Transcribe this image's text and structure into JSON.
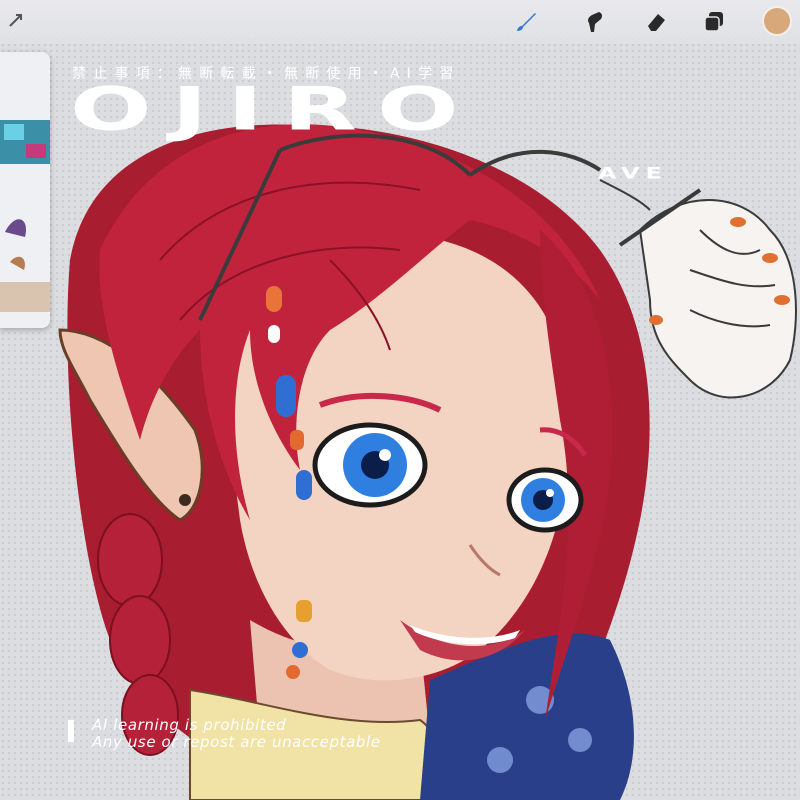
{
  "toolbar": {
    "tools": [
      "actions-icon",
      "brush-icon",
      "smudge-icon",
      "eraser-icon",
      "layers-icon"
    ],
    "selected_tool": "brush-icon",
    "active_color": "#d9a87a",
    "brush_color": "#2f74d6"
  },
  "overlay": {
    "notice_jp": "禁止事項：無断転載・無断使用・AI学習",
    "title": "OJIRO",
    "subtitle": "AVE",
    "footer_line_1": "AI learning is prohibited",
    "footer_line_2": "Any use or repost are unacceptable"
  },
  "palette": {
    "hair": "#b81f35",
    "skin": "#f2d2c0",
    "eye": "#2f7fe0"
  }
}
